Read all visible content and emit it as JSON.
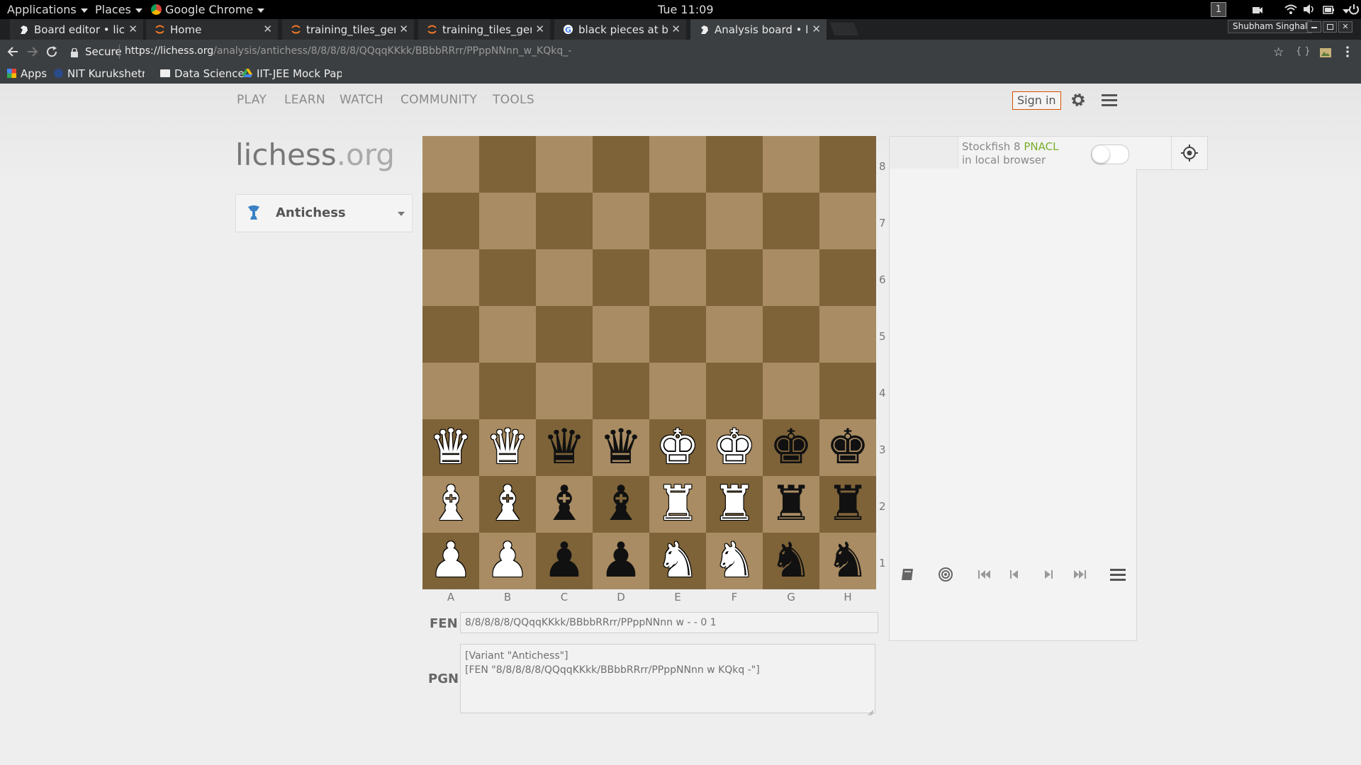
{
  "gnome_panel": {
    "applications": "Applications",
    "places": "Places",
    "app": "Google Chrome",
    "clock": "Tue 11:09",
    "workspace": "1"
  },
  "tabs": [
    {
      "label": "Board editor • liche",
      "icon": "lichess-icon"
    },
    {
      "label": "Home",
      "icon": "jupyter-icon"
    },
    {
      "label": "training_tiles_gener",
      "icon": "jupyter-icon"
    },
    {
      "label": "training_tiles_gener",
      "icon": "jupyter-icon"
    },
    {
      "label": "black pieces at botto",
      "icon": "google-icon"
    },
    {
      "label": "Analysis board • lich",
      "icon": "lichess-icon",
      "active": true
    }
  ],
  "profile_name": "Shubham Singhal",
  "omnibox": {
    "secure_label": "Secure",
    "url_host": "https://lichess.org",
    "url_path": "/analysis/antichess/8/8/8/8/8/QQqqKKkk/BBbbRRrr/PPppNNnn_w_KQkq_-"
  },
  "bookmarks": [
    {
      "label": "Apps",
      "icon": "apps-grid-icon"
    },
    {
      "label": "NIT Kurukshetra L",
      "icon": "nit-icon"
    },
    {
      "label": "Data Science",
      "icon": "folder-icon"
    },
    {
      "label": "IIT-JEE Mock Pap",
      "icon": "drive-icon"
    }
  ],
  "site": {
    "nav": [
      "PLAY",
      "LEARN",
      "WATCH",
      "COMMUNITY",
      "TOOLS"
    ],
    "sign_in": "Sign in",
    "logo_main": "lichess",
    "logo_suffix": ".org",
    "variant": "Antichess",
    "engine_name": "Stockfish 8",
    "engine_tag": "PNACL",
    "engine_sub": "in local browser",
    "fen_label": "FEN",
    "fen_value": "8/8/8/8/8/QQqqKKkk/BBbbRRrr/PPppNNnn w - - 0 1",
    "pgn_label": "PGN",
    "pgn_line1": "[Variant \"Antichess\"]",
    "pgn_line2": "[FEN \"8/8/8/8/8/QQqqKKkk/BBbbRRrr/PPppNNnn w KQkq -\"]"
  },
  "board": {
    "files": [
      "A",
      "B",
      "C",
      "D",
      "E",
      "F",
      "G",
      "H"
    ],
    "ranks": [
      "8",
      "7",
      "6",
      "5",
      "4",
      "3",
      "2",
      "1"
    ],
    "pieces": [
      {
        "square": "a3",
        "piece": "white-queen"
      },
      {
        "square": "b3",
        "piece": "white-queen"
      },
      {
        "square": "c3",
        "piece": "black-queen"
      },
      {
        "square": "d3",
        "piece": "black-queen"
      },
      {
        "square": "e3",
        "piece": "white-king"
      },
      {
        "square": "f3",
        "piece": "white-king"
      },
      {
        "square": "g3",
        "piece": "black-king"
      },
      {
        "square": "h3",
        "piece": "black-king"
      },
      {
        "square": "a2",
        "piece": "white-bishop"
      },
      {
        "square": "b2",
        "piece": "white-bishop"
      },
      {
        "square": "c2",
        "piece": "black-bishop"
      },
      {
        "square": "d2",
        "piece": "black-bishop"
      },
      {
        "square": "e2",
        "piece": "white-rook"
      },
      {
        "square": "f2",
        "piece": "white-rook"
      },
      {
        "square": "g2",
        "piece": "black-rook"
      },
      {
        "square": "h2",
        "piece": "black-rook"
      },
      {
        "square": "a1",
        "piece": "white-pawn"
      },
      {
        "square": "b1",
        "piece": "white-pawn"
      },
      {
        "square": "c1",
        "piece": "black-pawn"
      },
      {
        "square": "d1",
        "piece": "black-pawn"
      },
      {
        "square": "e1",
        "piece": "white-knight"
      },
      {
        "square": "f1",
        "piece": "white-knight"
      },
      {
        "square": "g1",
        "piece": "black-knight"
      },
      {
        "square": "h1",
        "piece": "black-knight"
      }
    ]
  },
  "colors": {
    "board_light": "#a98c63",
    "board_dark": "#7e6339",
    "sign_in_border": "#d85000",
    "engine_accent": "#7aae2a"
  }
}
